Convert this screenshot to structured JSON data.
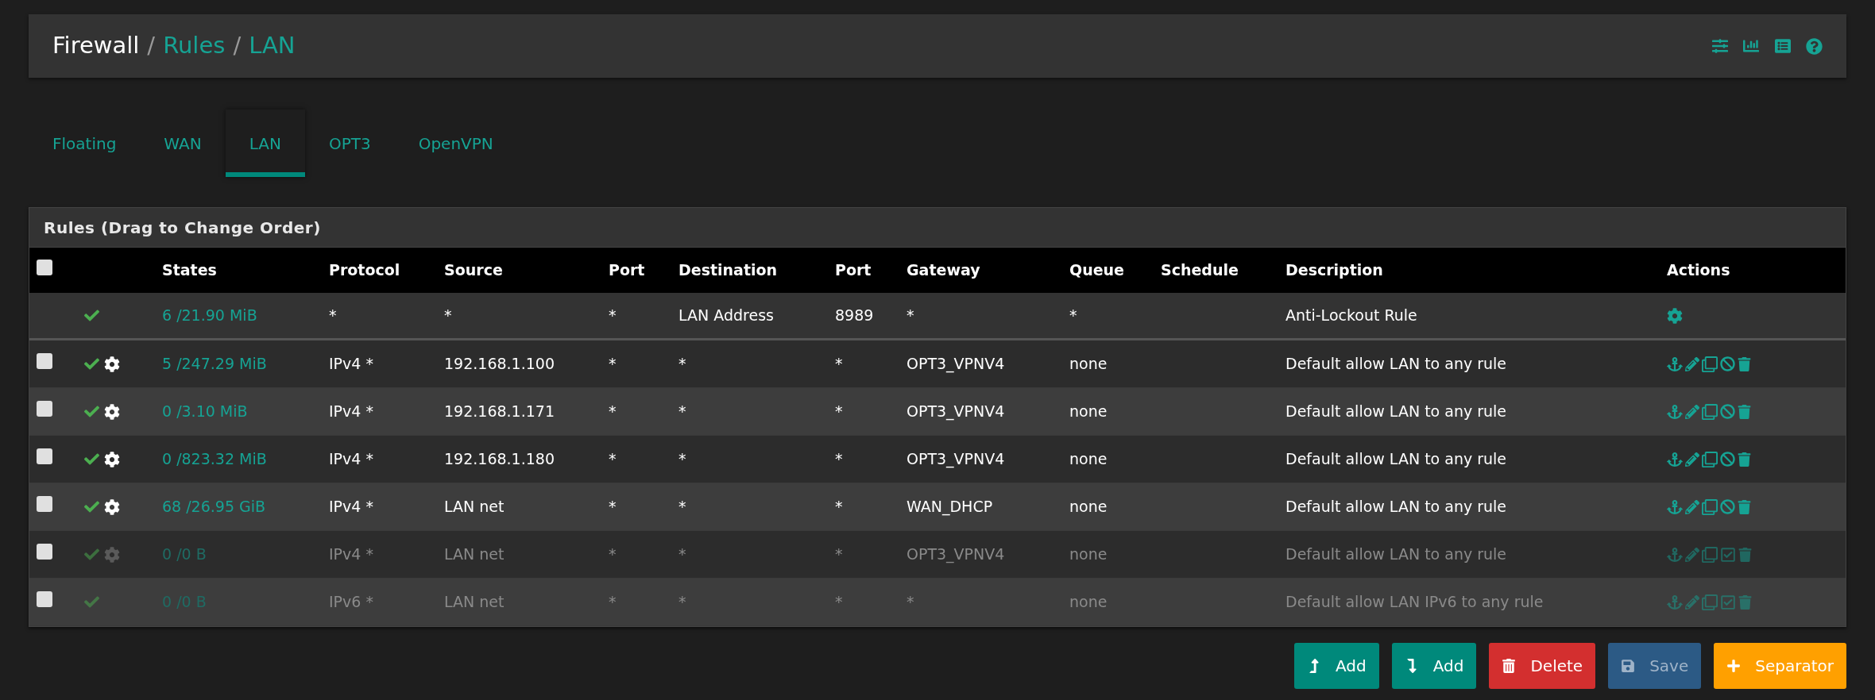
{
  "breadcrumb": [
    {
      "label": "Firewall",
      "link": false
    },
    {
      "label": "Rules",
      "link": true
    },
    {
      "label": "LAN",
      "link": true
    }
  ],
  "breadcrumb_separators": [
    "/",
    "/"
  ],
  "tabs": [
    {
      "label": "Floating",
      "selected": false
    },
    {
      "label": "WAN",
      "selected": false
    },
    {
      "label": "LAN",
      "selected": true
    },
    {
      "label": "OPT3",
      "selected": false
    },
    {
      "label": "OpenVPN",
      "selected": false
    }
  ],
  "panel_title": "Rules (Drag to Change Order)",
  "columns": [
    "States",
    "Protocol",
    "Source",
    "Port",
    "Destination",
    "Port",
    "Gateway",
    "Queue",
    "Schedule",
    "Description",
    "Actions"
  ],
  "select_all_checked": false,
  "rows": [
    {
      "kind": "lockout",
      "disabled": false,
      "advanced": false,
      "cells": [
        "6 /21.90 MiB",
        "*",
        "*",
        "*",
        "LAN Address",
        "8989",
        "*",
        "*",
        "",
        "Anti-Lockout Rule"
      ]
    },
    {
      "kind": "rule",
      "disabled": false,
      "advanced": true,
      "checked": false,
      "cells": [
        "5 /247.29 MiB",
        "IPv4 *",
        "192.168.1.100",
        "*",
        "*",
        "*",
        "OPT3_VPNV4",
        "none",
        "",
        "Default allow LAN to any rule"
      ]
    },
    {
      "kind": "rule",
      "disabled": false,
      "advanced": true,
      "checked": false,
      "cells": [
        "0 /3.10 MiB",
        "IPv4 *",
        "192.168.1.171",
        "*",
        "*",
        "*",
        "OPT3_VPNV4",
        "none",
        "",
        "Default allow LAN to any rule"
      ]
    },
    {
      "kind": "rule",
      "disabled": false,
      "advanced": true,
      "checked": false,
      "cells": [
        "0 /823.32 MiB",
        "IPv4 *",
        "192.168.1.180",
        "*",
        "*",
        "*",
        "OPT3_VPNV4",
        "none",
        "",
        "Default allow LAN to any rule"
      ]
    },
    {
      "kind": "rule",
      "disabled": false,
      "advanced": true,
      "checked": false,
      "cells": [
        "68 /26.95 GiB",
        "IPv4 *",
        "LAN net",
        "*",
        "*",
        "*",
        "WAN_DHCP",
        "none",
        "",
        "Default allow LAN to any rule"
      ]
    },
    {
      "kind": "rule",
      "disabled": true,
      "advanced": true,
      "checked": false,
      "cells": [
        "0 /0 B",
        "IPv4 *",
        "LAN net",
        "*",
        "*",
        "*",
        "OPT3_VPNV4",
        "none",
        "",
        "Default allow LAN to any rule"
      ]
    },
    {
      "kind": "rule",
      "disabled": true,
      "advanced": false,
      "checked": false,
      "cells": [
        "0 /0 B",
        "IPv6 *",
        "LAN net",
        "*",
        "*",
        "*",
        "*",
        "none",
        "",
        "Default allow LAN IPv6 to any rule"
      ]
    }
  ],
  "buttons": [
    {
      "kind": "add-top",
      "label": "Add",
      "disabled": false
    },
    {
      "kind": "add-bottom",
      "label": "Add",
      "disabled": false
    },
    {
      "kind": "delete",
      "label": "Delete",
      "disabled": false
    },
    {
      "kind": "save",
      "label": "Save",
      "disabled": true
    },
    {
      "kind": "separator",
      "label": "Separator",
      "disabled": false
    }
  ]
}
